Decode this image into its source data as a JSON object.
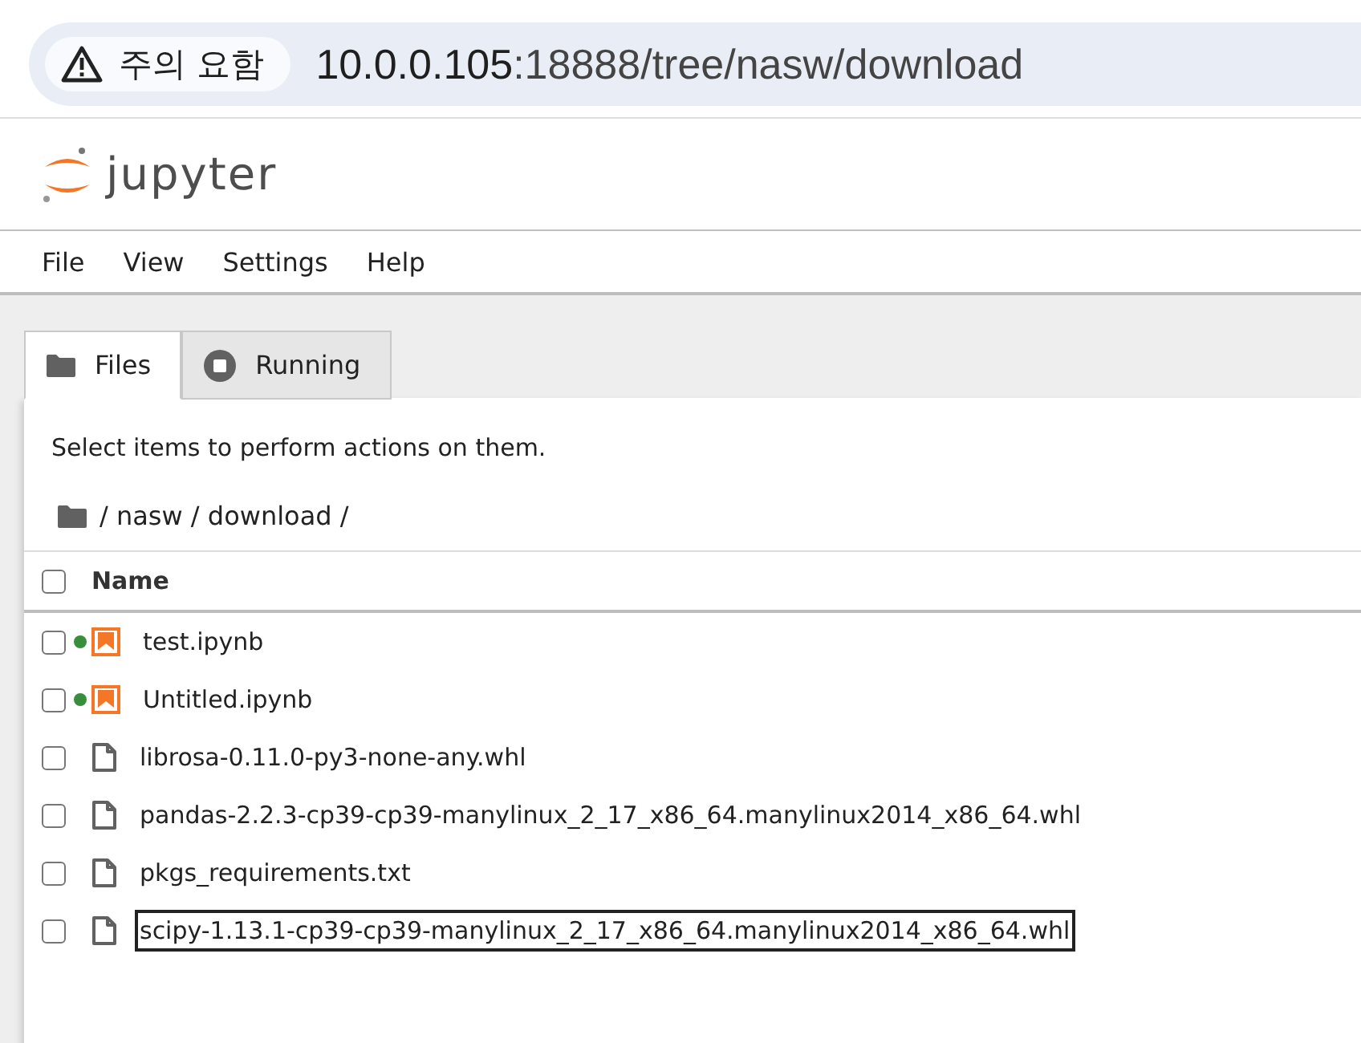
{
  "address_bar": {
    "security_label": "주의 요함",
    "host": "10.0.0.105",
    "path": ":18888/tree/nasw/download"
  },
  "logo_text": "jupyter",
  "menu": [
    "File",
    "View",
    "Settings",
    "Help"
  ],
  "tabs": [
    {
      "label": "Files",
      "selected": true,
      "kind": "files"
    },
    {
      "label": "Running",
      "selected": false,
      "kind": "running"
    }
  ],
  "hint": "Select items to perform actions on them.",
  "breadcrumb": "/ nasw / download /",
  "table": {
    "select_all_checked": false,
    "column": "Name",
    "rows": [
      {
        "name": "test.ipynb",
        "kind": "notebook",
        "running": true,
        "checked": false,
        "focused": false
      },
      {
        "name": "Untitled.ipynb",
        "kind": "notebook",
        "running": true,
        "checked": false,
        "focused": false
      },
      {
        "name": "librosa-0.11.0-py3-none-any.whl",
        "kind": "file",
        "running": false,
        "checked": false,
        "focused": false
      },
      {
        "name": "pandas-2.2.3-cp39-cp39-manylinux_2_17_x86_64.manylinux2014_x86_64.whl",
        "kind": "file",
        "running": false,
        "checked": false,
        "focused": false
      },
      {
        "name": "pkgs_requirements.txt",
        "kind": "file",
        "running": false,
        "checked": false,
        "focused": false
      },
      {
        "name": "scipy-1.13.1-cp39-cp39-manylinux_2_17_x86_64.manylinux2014_x86_64.whl",
        "kind": "file",
        "running": false,
        "checked": false,
        "focused": true
      }
    ]
  }
}
